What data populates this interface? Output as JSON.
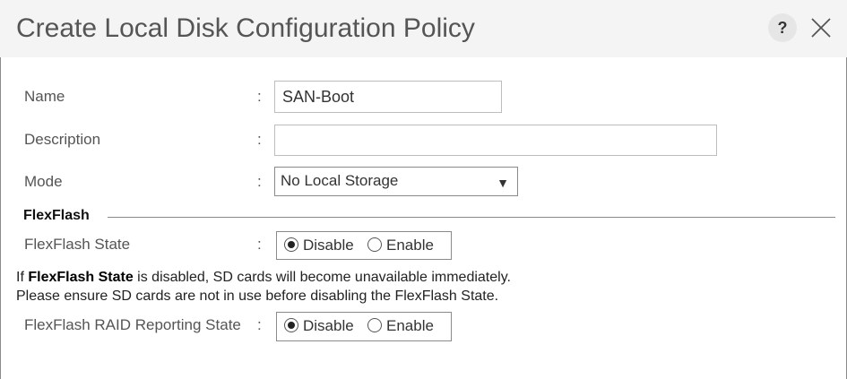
{
  "dialog": {
    "title": "Create Local Disk Configuration Policy",
    "help_label": "?",
    "close_icon": "close-icon"
  },
  "form": {
    "name": {
      "label": "Name",
      "value": "SAN-Boot"
    },
    "description": {
      "label": "Description",
      "value": ""
    },
    "mode": {
      "label": "Mode",
      "selected": "No Local Storage",
      "arrow": "▼"
    },
    "colon": ":"
  },
  "flexflash": {
    "section_title": "FlexFlash",
    "state": {
      "label": "FlexFlash State",
      "options": [
        {
          "label": "Disable",
          "checked": true
        },
        {
          "label": "Enable",
          "checked": false
        }
      ]
    },
    "note": {
      "line1_prefix": "If ",
      "line1_bold": "FlexFlash State",
      "line1_suffix": " is disabled, SD cards will become unavailable immediately.",
      "line2": "Please ensure SD cards are not in use before disabling the FlexFlash State."
    },
    "raid": {
      "label": "FlexFlash RAID Reporting State",
      "options": [
        {
          "label": "Disable",
          "checked": true
        },
        {
          "label": "Enable",
          "checked": false
        }
      ]
    }
  }
}
